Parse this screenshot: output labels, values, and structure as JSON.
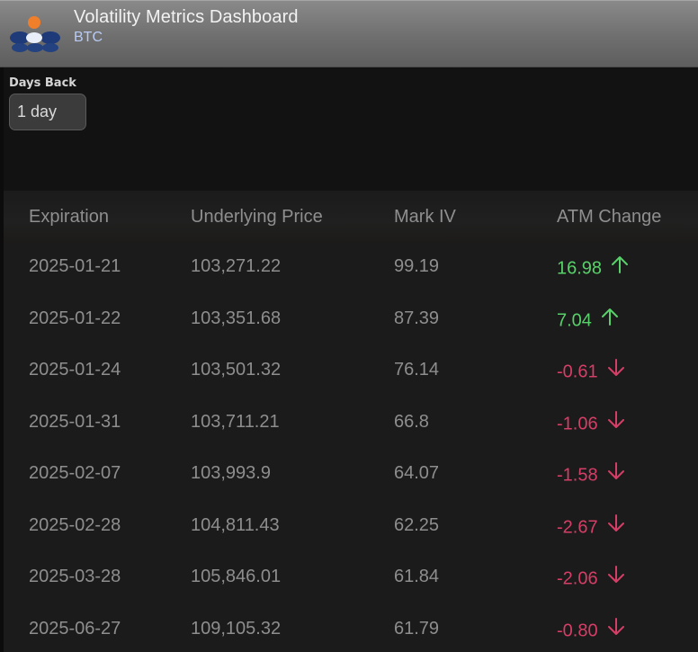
{
  "header": {
    "title": "Volatility Metrics Dashboard",
    "subtitle": "BTC"
  },
  "controls": {
    "days_back_label": "Days Back",
    "days_back_value": "1 day"
  },
  "table": {
    "columns": [
      "Expiration",
      "Underlying Price",
      "Mark IV",
      "ATM Change"
    ],
    "rows": [
      {
        "expiration": "2025-01-21",
        "price": "103,271.22",
        "mark_iv": "99.19",
        "atm_change": "16.98",
        "direction": "up"
      },
      {
        "expiration": "2025-01-22",
        "price": "103,351.68",
        "mark_iv": "87.39",
        "atm_change": "7.04",
        "direction": "up"
      },
      {
        "expiration": "2025-01-24",
        "price": "103,501.32",
        "mark_iv": "76.14",
        "atm_change": "-0.61",
        "direction": "down"
      },
      {
        "expiration": "2025-01-31",
        "price": "103,711.21",
        "mark_iv": "66.8",
        "atm_change": "-1.06",
        "direction": "down"
      },
      {
        "expiration": "2025-02-07",
        "price": "103,993.9",
        "mark_iv": "64.07",
        "atm_change": "-1.58",
        "direction": "down"
      },
      {
        "expiration": "2025-02-28",
        "price": "104,811.43",
        "mark_iv": "62.25",
        "atm_change": "-2.67",
        "direction": "down"
      },
      {
        "expiration": "2025-03-28",
        "price": "105,846.01",
        "mark_iv": "61.84",
        "atm_change": "-2.06",
        "direction": "down"
      },
      {
        "expiration": "2025-06-27",
        "price": "109,105.32",
        "mark_iv": "61.79",
        "atm_change": "-0.80",
        "direction": "down"
      }
    ]
  },
  "colors": {
    "up": "#59d16a",
    "down": "#d53e66",
    "accent": "#b9cbf3"
  },
  "icons": {
    "up": "arrow-up-icon",
    "down": "arrow-down-icon",
    "logo": "app-logo-icon"
  }
}
